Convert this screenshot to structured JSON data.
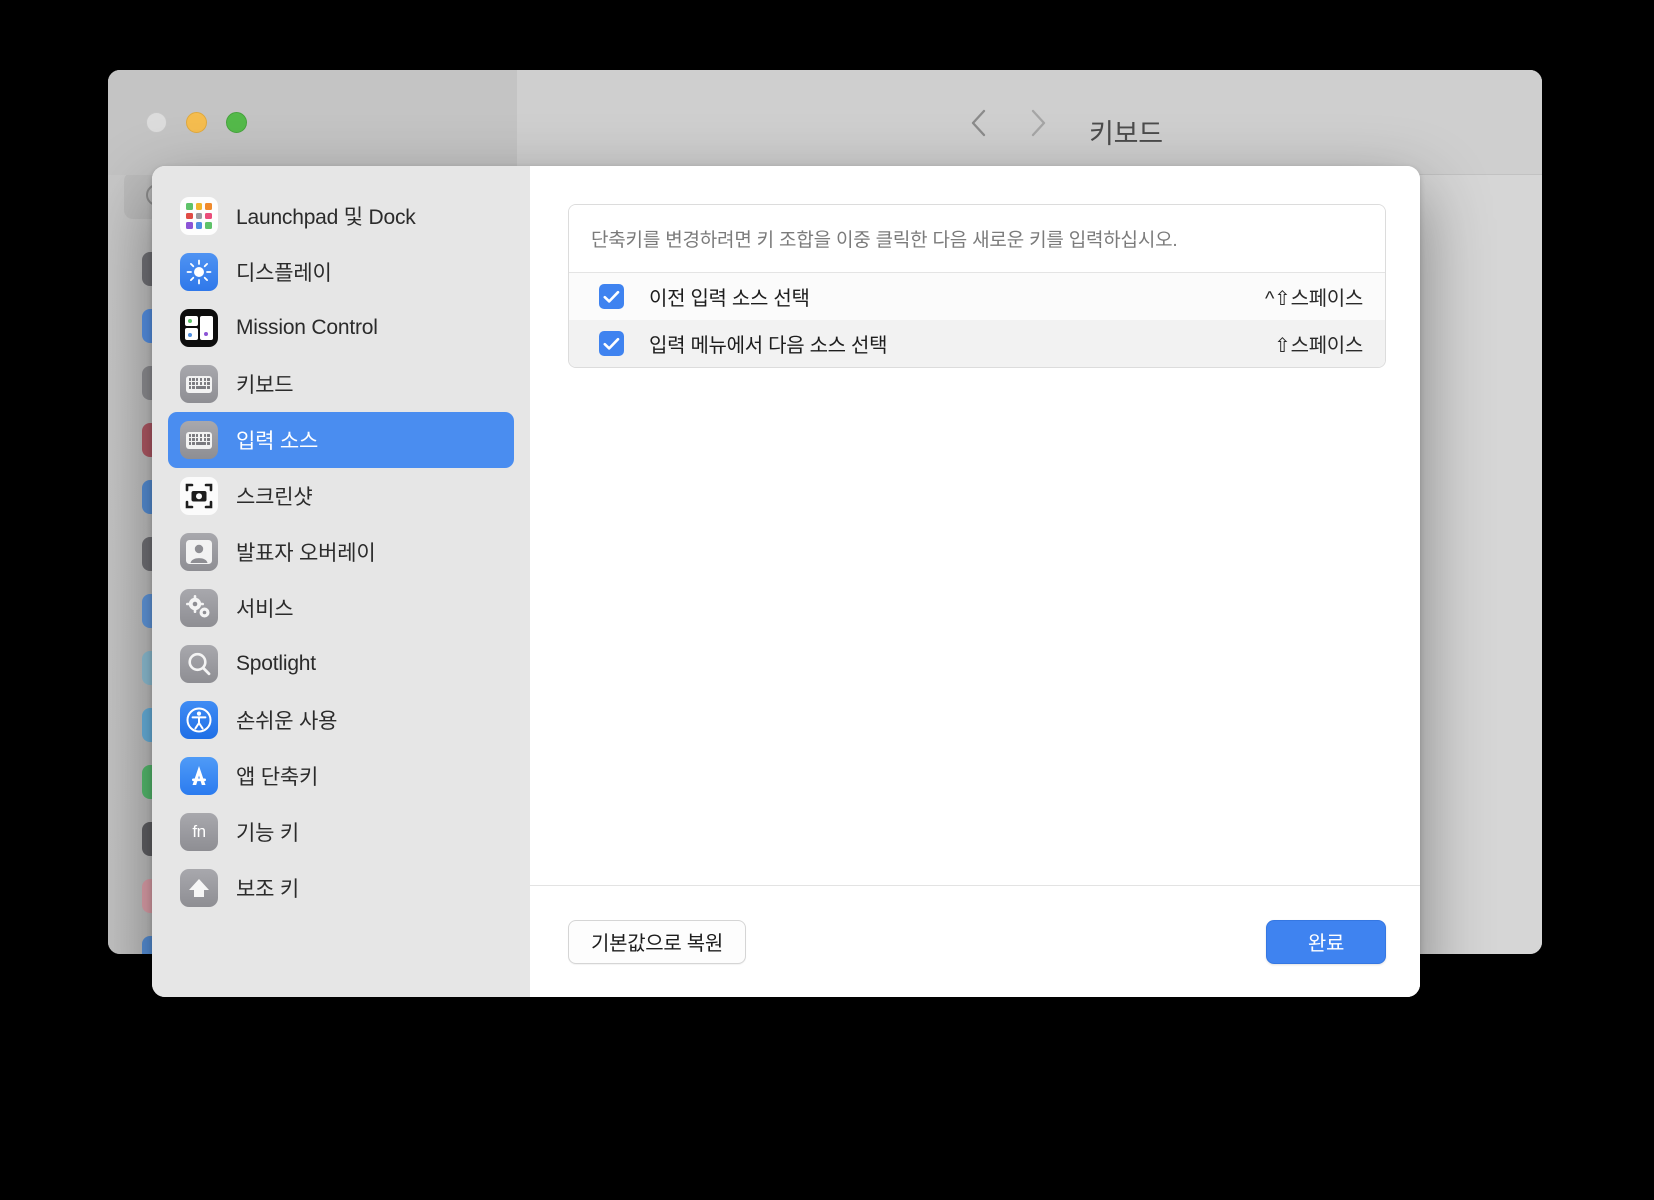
{
  "window": {
    "title": "키보드",
    "traffic_lights": [
      {
        "name": "close",
        "color": "#dcdcdc",
        "enabled": false
      },
      {
        "name": "minimize",
        "color": "#f5bd4f",
        "enabled": true
      },
      {
        "name": "maximize",
        "color": "#54ba4a",
        "enabled": true
      }
    ],
    "nav": {
      "back_icon": "chevron-left-icon",
      "forward_icon": "chevron-right-icon"
    }
  },
  "sheet": {
    "categories": [
      {
        "label": "Launchpad 및 Dock",
        "icon": "launchpad-icon",
        "selected": false
      },
      {
        "label": "디스플레이",
        "icon": "display-icon",
        "selected": false
      },
      {
        "label": "Mission Control",
        "icon": "mission-control-icon",
        "selected": false
      },
      {
        "label": "키보드",
        "icon": "keyboard-icon",
        "selected": false
      },
      {
        "label": "입력 소스",
        "icon": "input-sources-icon",
        "selected": true
      },
      {
        "label": "스크린샷",
        "icon": "screenshot-icon",
        "selected": false
      },
      {
        "label": "발표자 오버레이",
        "icon": "presenter-overlay-icon",
        "selected": false
      },
      {
        "label": "서비스",
        "icon": "services-icon",
        "selected": false
      },
      {
        "label": "Spotlight",
        "icon": "spotlight-icon",
        "selected": false
      },
      {
        "label": "손쉬운 사용",
        "icon": "accessibility-icon",
        "selected": false
      },
      {
        "label": "앱 단축키",
        "icon": "app-shortcuts-icon",
        "selected": false
      },
      {
        "label": "기능 키",
        "icon": "function-keys-icon",
        "selected": false
      },
      {
        "label": "보조 키",
        "icon": "modifier-keys-icon",
        "selected": false
      }
    ],
    "hint": "단축키를 변경하려면 키 조합을 이중 클릭한 다음 새로운 키를 입력하십시오.",
    "shortcuts": [
      {
        "label": "이전 입력 소스 선택",
        "keys": "^⇧스페이스",
        "checked": true
      },
      {
        "label": "입력 메뉴에서 다음 소스 선택",
        "keys": "⇧스페이스",
        "checked": true
      }
    ],
    "footer": {
      "restore_label": "기본값으로 복원",
      "done_label": "완료"
    }
  },
  "colors": {
    "accent": "#3f83f0",
    "selection": "#4a8df0",
    "sheet_sidebar": "#e6e6e6",
    "row_odd": "#fbfbfb",
    "row_even": "#f2f2f2"
  }
}
